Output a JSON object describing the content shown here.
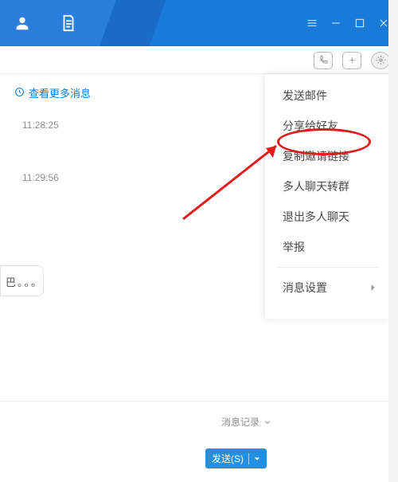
{
  "colors": {
    "accent": "#238fe0",
    "danger": "#e21b1b",
    "link": "#0a7bd6"
  },
  "titlebar": {
    "icons": {
      "contacts": "contacts-icon",
      "document": "document-icon"
    },
    "window_controls": {
      "menu": "menu-icon",
      "minimize": "minimize-icon",
      "maximize": "maximize-icon",
      "close": "close-icon"
    }
  },
  "chat_toolbar": {
    "icons": {
      "call": "phone-icon",
      "add": "add-square-icon",
      "settings": "gear-icon"
    }
  },
  "chat": {
    "more_messages_label": "查看更多消息",
    "timestamps": [
      "11:28:25",
      "11:29:56"
    ],
    "bubble_text": "巴。。。"
  },
  "footer": {
    "history_label": "消息记录",
    "send_button_label": "发送(S)"
  },
  "menu": {
    "items": [
      "发送邮件",
      "分享给好友",
      "复制邀请链接",
      "多人聊天转群",
      "退出多人聊天",
      "举报"
    ],
    "settings_label": "消息设置"
  },
  "annotation": {
    "highlighted_item_index": 2
  }
}
